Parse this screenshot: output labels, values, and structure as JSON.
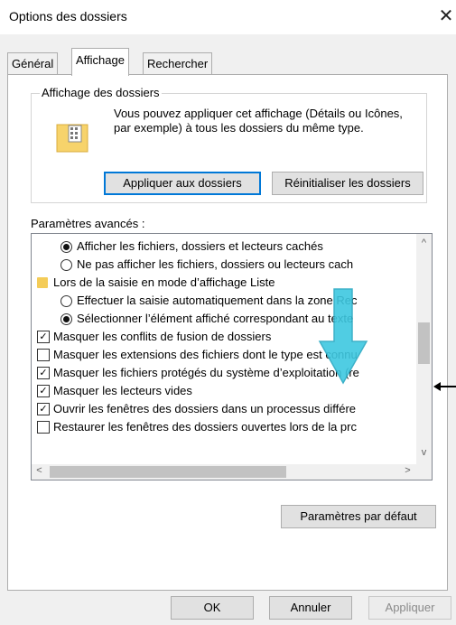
{
  "window": {
    "title": "Options des dossiers"
  },
  "tabs": [
    {
      "label": "Général"
    },
    {
      "label": "Affichage"
    },
    {
      "label": "Rechercher"
    }
  ],
  "folder_views": {
    "label": "Affichage des dossiers",
    "description": "Vous pouvez appliquer cet affichage (Détails ou Icônes, par exemple) à tous les dossiers du même type.",
    "apply_button": "Appliquer aux dossiers",
    "reset_button": "Réinitialiser les dossiers"
  },
  "advanced": {
    "label": "Paramètres avancés :",
    "items": [
      {
        "type": "radio",
        "checked": true,
        "indent": 2,
        "text": "Afficher les fichiers, dossiers et lecteurs cachés"
      },
      {
        "type": "radio",
        "checked": false,
        "indent": 2,
        "text": "Ne pas afficher les fichiers, dossiers ou lecteurs cach"
      },
      {
        "type": "folder",
        "indent": 1,
        "text": "Lors de la saisie en mode d’affichage Liste"
      },
      {
        "type": "radio",
        "checked": false,
        "indent": 2,
        "text": "Effectuer la saisie automatiquement dans la zone Rec"
      },
      {
        "type": "radio",
        "checked": true,
        "indent": 2,
        "text": "Sélectionner l’élément affiché correspondant au texte"
      },
      {
        "type": "check",
        "checked": true,
        "indent": 1,
        "text": "Masquer les conflits de fusion de dossiers"
      },
      {
        "type": "check",
        "checked": false,
        "indent": 1,
        "text": "Masquer les extensions des fichiers dont le type est connu"
      },
      {
        "type": "check",
        "checked": true,
        "indent": 1,
        "text": "Masquer les fichiers protégés du système d’exploitation (re"
      },
      {
        "type": "check",
        "checked": true,
        "indent": 1,
        "text": "Masquer les lecteurs vides"
      },
      {
        "type": "check",
        "checked": true,
        "indent": 1,
        "text": "Ouvrir les fenêtres des dossiers dans un processus différe"
      },
      {
        "type": "check",
        "checked": false,
        "indent": 1,
        "text": "Restaurer les fenêtres des dossiers ouvertes lors de la prc"
      }
    ],
    "scroll_up": "^",
    "scroll_down": "v",
    "scroll_left": "<",
    "scroll_right": ">"
  },
  "restore_defaults_button": "Paramètres par défaut",
  "footer": {
    "ok": "OK",
    "cancel": "Annuler",
    "apply": "Appliquer"
  },
  "colors": {
    "accent": "#0078d7",
    "annotation_arrow": "#3ec8e0"
  }
}
